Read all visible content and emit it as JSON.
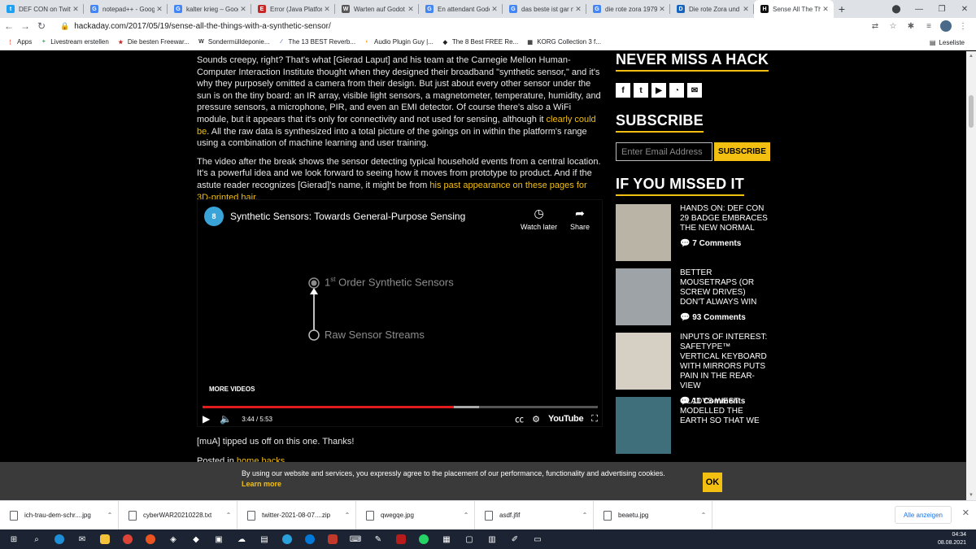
{
  "browser": {
    "tabs": [
      {
        "title": "DEF CON on Twitter",
        "fav_color": "#1da1f2",
        "fav_glyph": "t"
      },
      {
        "title": "notepad++ - Google",
        "fav_color": "#4285f4",
        "fav_glyph": "G"
      },
      {
        "title": "kalter krieg – Google",
        "fav_color": "#4285f4",
        "fav_glyph": "G"
      },
      {
        "title": "Error (Java Platform",
        "fav_color": "#c62828",
        "fav_glyph": "E"
      },
      {
        "title": "Warten auf Godot",
        "fav_color": "#555555",
        "fav_glyph": "W"
      },
      {
        "title": "En attendant Godot",
        "fav_color": "#4285f4",
        "fav_glyph": "G"
      },
      {
        "title": "das beste ist gar nicht",
        "fav_color": "#4285f4",
        "fav_glyph": "G"
      },
      {
        "title": "die rote zora 1979",
        "fav_color": "#4285f4",
        "fav_glyph": "G"
      },
      {
        "title": "Die rote Zora und ihre",
        "fav_color": "#1565c0",
        "fav_glyph": "D"
      },
      {
        "title": "Sense All The Things",
        "fav_color": "#111111",
        "fav_glyph": "H",
        "active": true
      }
    ],
    "url": "hackaday.com/2017/05/19/sense-all-the-things-with-a-synthetic-sensor/",
    "bookmarks": [
      {
        "label": "Apps",
        "color": "#ea4335",
        "glyph": "⋮"
      },
      {
        "label": "Livestream erstellen",
        "color": "#34a853",
        "glyph": "+"
      },
      {
        "label": "Die besten Freewar...",
        "color": "#c62828",
        "glyph": "★"
      },
      {
        "label": "Sondermülldeponie...",
        "color": "#333333",
        "glyph": "W"
      },
      {
        "label": "The 13 BEST Reverb...",
        "color": "#5c6bc0",
        "glyph": "∕"
      },
      {
        "label": "Audio Plugin Guy |...",
        "color": "#f9a825",
        "glyph": "◐"
      },
      {
        "label": "The 8 Best FREE Re...",
        "color": "#222222",
        "glyph": "◆"
      },
      {
        "label": "KORG Collection 3 f...",
        "color": "#333333",
        "glyph": "▦"
      }
    ],
    "reading_list": "Leseliste"
  },
  "article": {
    "p1_text": "Sounds creepy, right? That's what [Gierad Laput] and his team at the Carnegie Mellon Human-Computer Interaction Institute thought when they designed their broadband \"synthetic sensor,\" and it's why they purposely omitted a camera from their design. But just about every other sensor under the sun is on the tiny board: an IR array, visible light sensors, a magnetometer, temperature, humidity, and pressure sensors, a microphone, PIR, and even an EMI detector. Of course there's also a WiFi module, but it appears that it's only for connectivity and not used for sensing, although it ",
    "p1_link": "clearly could be",
    "p1_tail": ". All the raw data is synthesized into a total picture of the goings on in within the platform's range using a combination of machine learning and user training.",
    "p2_text": "The video after the break shows the sensor detecting typical household events from a central location. It's a powerful idea and we look forward to seeing how it moves from prototype to product. And if the astute reader recognizes [Gierad]'s name, it might be from ",
    "p2_link": "his past appearance on these pages for 3D-printed hair",
    "p2_tail": ".",
    "after_video": "[muA] tipped us off on this one. Thanks!",
    "posted_prefix": "Posted in ",
    "posted_link": "home hacks"
  },
  "video": {
    "channel_logo": "8",
    "title": "Synthetic Sensors: Towards General-Purpose Sensing",
    "watch_later": "Watch later",
    "share": "Share",
    "diagram_top": "1st Order Synthetic Sensors",
    "diagram_top_sup": "st",
    "diagram_top_num": "1",
    "diagram_top_rest": " Order Synthetic Sensors",
    "diagram_bottom": "Raw Sensor Streams",
    "more_videos": "MORE VIDEOS",
    "time": "3:44 / 5:53",
    "played_fraction": 0.635,
    "buffered_fraction": 0.7,
    "youtube": "YouTube"
  },
  "sidebar": {
    "never_miss": "NEVER MISS A HACK",
    "social": [
      {
        "name": "facebook-icon",
        "glyph": "f"
      },
      {
        "name": "twitter-icon",
        "glyph": "t"
      },
      {
        "name": "youtube-icon",
        "glyph": "▶"
      },
      {
        "name": "rss-icon",
        "glyph": "◔"
      },
      {
        "name": "mail-icon",
        "glyph": "✉"
      }
    ],
    "subscribe": "SUBSCRIBE",
    "email_placeholder": "Enter Email Address",
    "subscribe_button": "SUBSCRIBE",
    "missed": "IF YOU MISSED IT",
    "posts": [
      {
        "title": "HANDS ON: DEF CON 29 BADGE EMBRACES THE NEW NORMAL",
        "comments": "7 Comments",
        "thumb": "#b9b4a6"
      },
      {
        "title": "BETTER MOUSETRAPS (OR SCREW DRIVES) DON'T ALWAYS WIN",
        "comments": "93 Comments",
        "thumb": "#9ea3a8"
      },
      {
        "title": "INPUTS OF INTEREST: SAFETYPE™ VERTICAL KEYBOARD WITH MIRRORS PUTS PAIN IN THE REAR-VIEW",
        "comments": "11 Comments",
        "thumb": "#d5d0c3"
      },
      {
        "title": "GLADYS WEST MODELLED THE EARTH SO THAT WE",
        "comments": "",
        "thumb": "#3f6f7a"
      }
    ]
  },
  "cookie": {
    "message": "By using our website and services, you expressly agree to the placement of our performance, functionality and advertising cookies.",
    "learn_more": "Learn more",
    "ok": "OK"
  },
  "downloads": {
    "items": [
      "ich-trau-dem-schr....jpg",
      "cyberWAR20210228.txt",
      "twitter-2021-08-07....zip",
      "qwegqe.jpg",
      "asdf.jfif",
      "beaetu.jpg"
    ],
    "show_all": "Alle anzeigen"
  },
  "taskbar": {
    "time": "04:34",
    "date": "08.08.2021"
  }
}
